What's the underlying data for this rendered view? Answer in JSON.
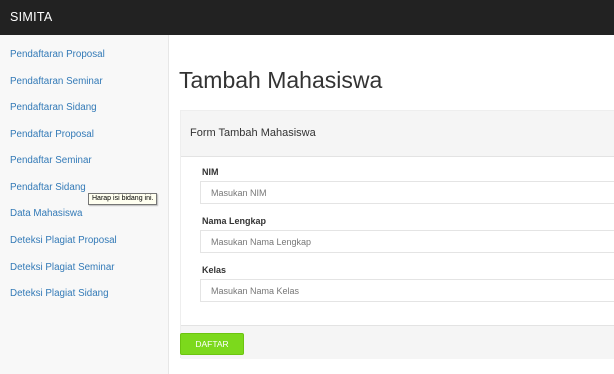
{
  "app": {
    "brand": "SIMITA"
  },
  "sidebar": {
    "items": [
      {
        "label": "Pendaftaran Proposal"
      },
      {
        "label": "Pendaftaran Seminar"
      },
      {
        "label": "Pendaftaran Sidang"
      },
      {
        "label": "Pendaftar Proposal"
      },
      {
        "label": "Pendaftar Seminar"
      },
      {
        "label": "Pendaftar Sidang"
      },
      {
        "label": "Data Mahasiswa"
      },
      {
        "label": "Deteksi Plagiat Proposal"
      },
      {
        "label": "Deteksi Plagiat Seminar"
      },
      {
        "label": "Deteksi Plagiat Sidang"
      }
    ]
  },
  "page": {
    "title": "Tambah Mahasiswa"
  },
  "form": {
    "title": "Form Tambah Mahasiswa",
    "fields": [
      {
        "label": "NIM",
        "placeholder": "Masukan NIM",
        "value": ""
      },
      {
        "label": "Nama Lengkap",
        "placeholder": "Masukan Nama Lengkap",
        "value": ""
      },
      {
        "label": "Kelas",
        "placeholder": "Masukan Nama Kelas",
        "value": ""
      }
    ],
    "validation_tooltip": "Harap isi bidang ini.",
    "submit_label": "DAFTAR"
  },
  "colors": {
    "topbar": "#222222",
    "link": "#337ab7",
    "submit": "#7cd91c"
  }
}
